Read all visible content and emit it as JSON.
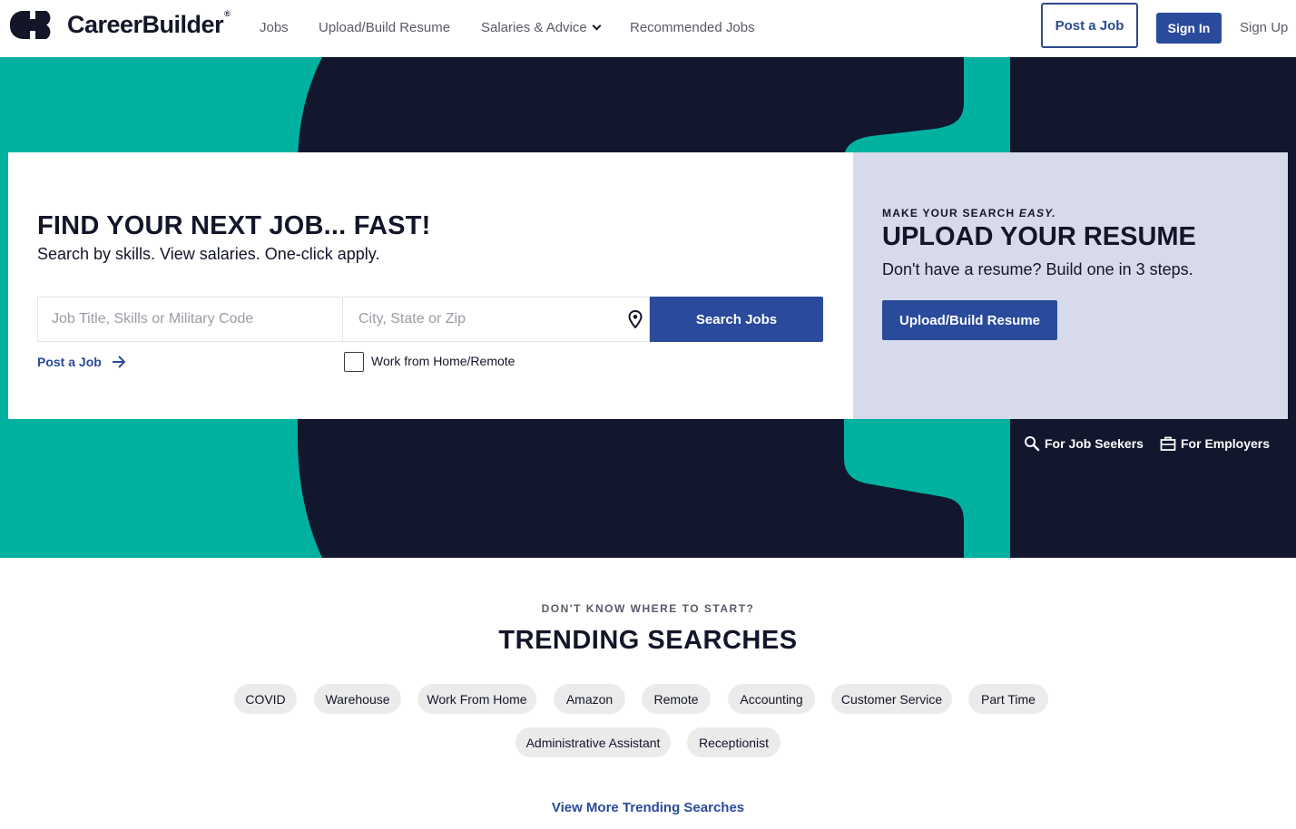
{
  "brand": {
    "name": "CareerBuilder",
    "reg": "®",
    "colors": {
      "navy": "#12172e",
      "teal": "#00b1a0",
      "blue": "#2a4a9b",
      "lavender": "#d6daeb"
    }
  },
  "nav": {
    "items": [
      {
        "label": "Jobs"
      },
      {
        "label": "Upload/Build Resume"
      },
      {
        "label": "Salaries & Advice",
        "icon": "chevron-down-icon"
      },
      {
        "label": "Recommended Jobs"
      }
    ],
    "post_job": "Post a Job",
    "sign_in": "Sign In",
    "sign_up": "Sign Up"
  },
  "search": {
    "headline": "FIND YOUR NEXT JOB... FAST!",
    "subline": "Search by skills. View salaries. One-click apply.",
    "job_placeholder": "Job Title, Skills or Military Code",
    "location_placeholder": "City, State or Zip",
    "location_icon": "map-pin-icon",
    "button": "Search Jobs",
    "post_job_link": "Post a Job",
    "remote_label": "Work from Home/Remote",
    "remote_checked": false
  },
  "resume": {
    "kicker_prefix": "MAKE YOUR SEARCH",
    "kicker_emphasis": "EASY.",
    "title": "UPLOAD YOUR RESUME",
    "subtitle": "Don't have a resume? Build one in 3 steps.",
    "button": "Upload/Build Resume"
  },
  "audience": {
    "seekers": "For Job Seekers",
    "employers": "For Employers"
  },
  "trending": {
    "kicker": "DON'T KNOW WHERE TO START?",
    "title": "TRENDING SEARCHES",
    "pills": [
      "COVID",
      "Warehouse",
      "Work From Home",
      "Amazon",
      "Remote",
      "Accounting",
      "Customer Service",
      "Part Time",
      "Administrative Assistant",
      "Receptionist"
    ],
    "view_more": "View More Trending Searches"
  }
}
